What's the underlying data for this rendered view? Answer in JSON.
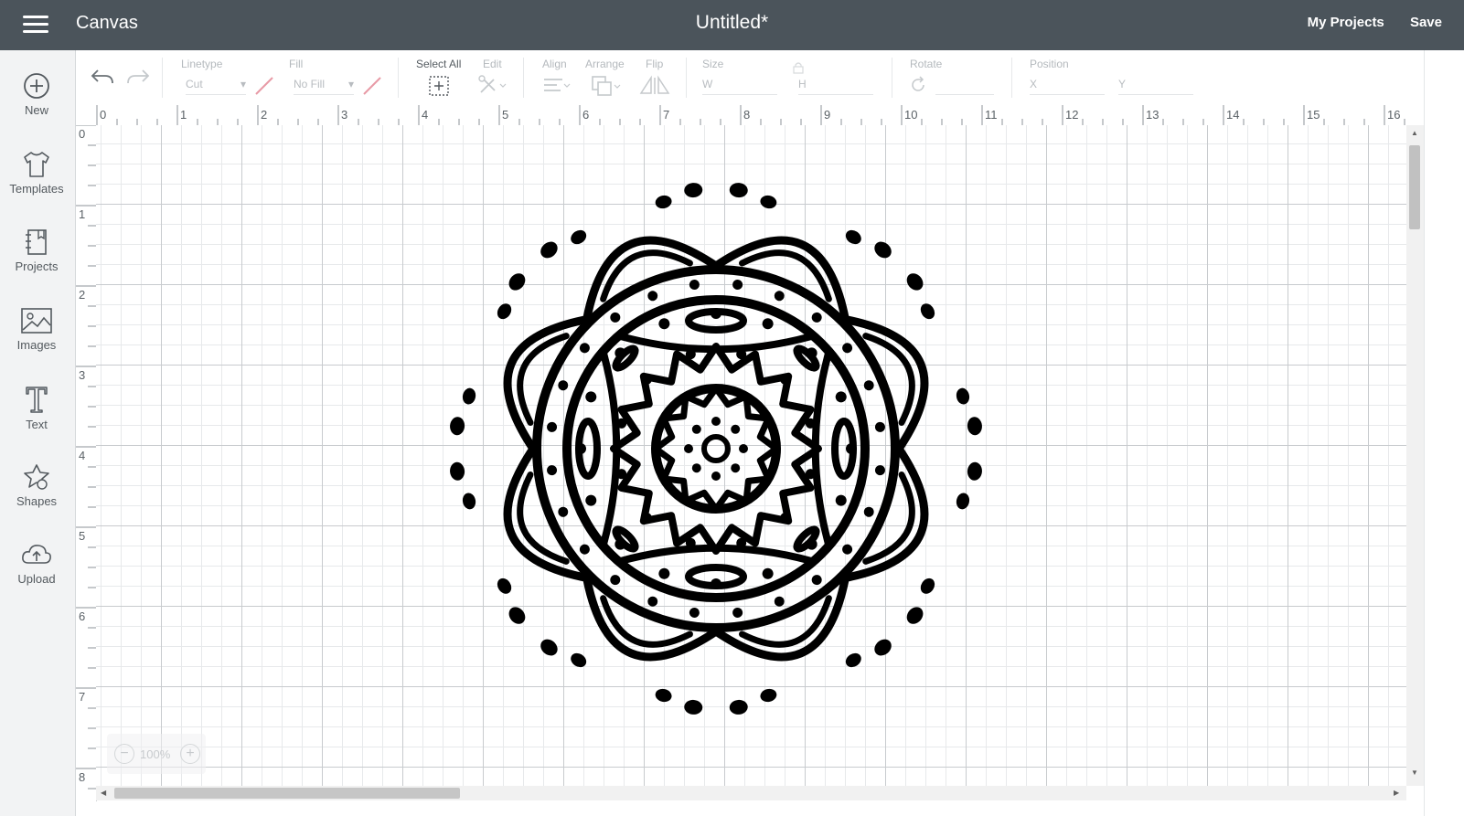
{
  "header": {
    "app_title": "Canvas",
    "doc_title": "Untitled*",
    "my_projects": "My Projects",
    "save": "Save"
  },
  "sidebar": {
    "items": [
      {
        "label": "New",
        "icon": "plus-circle-icon"
      },
      {
        "label": "Templates",
        "icon": "tshirt-icon"
      },
      {
        "label": "Projects",
        "icon": "notebook-icon"
      },
      {
        "label": "Images",
        "icon": "image-icon"
      },
      {
        "label": "Text",
        "icon": "text-t-icon"
      },
      {
        "label": "Shapes",
        "icon": "shapes-icon"
      },
      {
        "label": "Upload",
        "icon": "cloud-upload-icon"
      }
    ]
  },
  "toolbar": {
    "linetype_label": "Linetype",
    "linetype_value": "Cut",
    "fill_label": "Fill",
    "fill_value": "No Fill",
    "select_all": "Select All",
    "edit": "Edit",
    "align": "Align",
    "arrange": "Arrange",
    "flip": "Flip",
    "size": "Size",
    "w": "W",
    "h": "H",
    "rotate": "Rotate",
    "position": "Position",
    "x": "X",
    "y": "Y"
  },
  "rulers": {
    "top": [
      "0",
      "1",
      "2",
      "3",
      "4",
      "5",
      "6",
      "7",
      "8",
      "9",
      "10",
      "11",
      "12",
      "13",
      "14",
      "15",
      "16"
    ],
    "left": [
      "0",
      "1",
      "2",
      "3",
      "4",
      "5",
      "6",
      "7",
      "8"
    ]
  },
  "zoom": {
    "value": "100%"
  },
  "colors": {
    "header_bg": "#4b545b",
    "sidebar_bg": "#f2f3f4",
    "accent_pink": "#e89aa6"
  }
}
